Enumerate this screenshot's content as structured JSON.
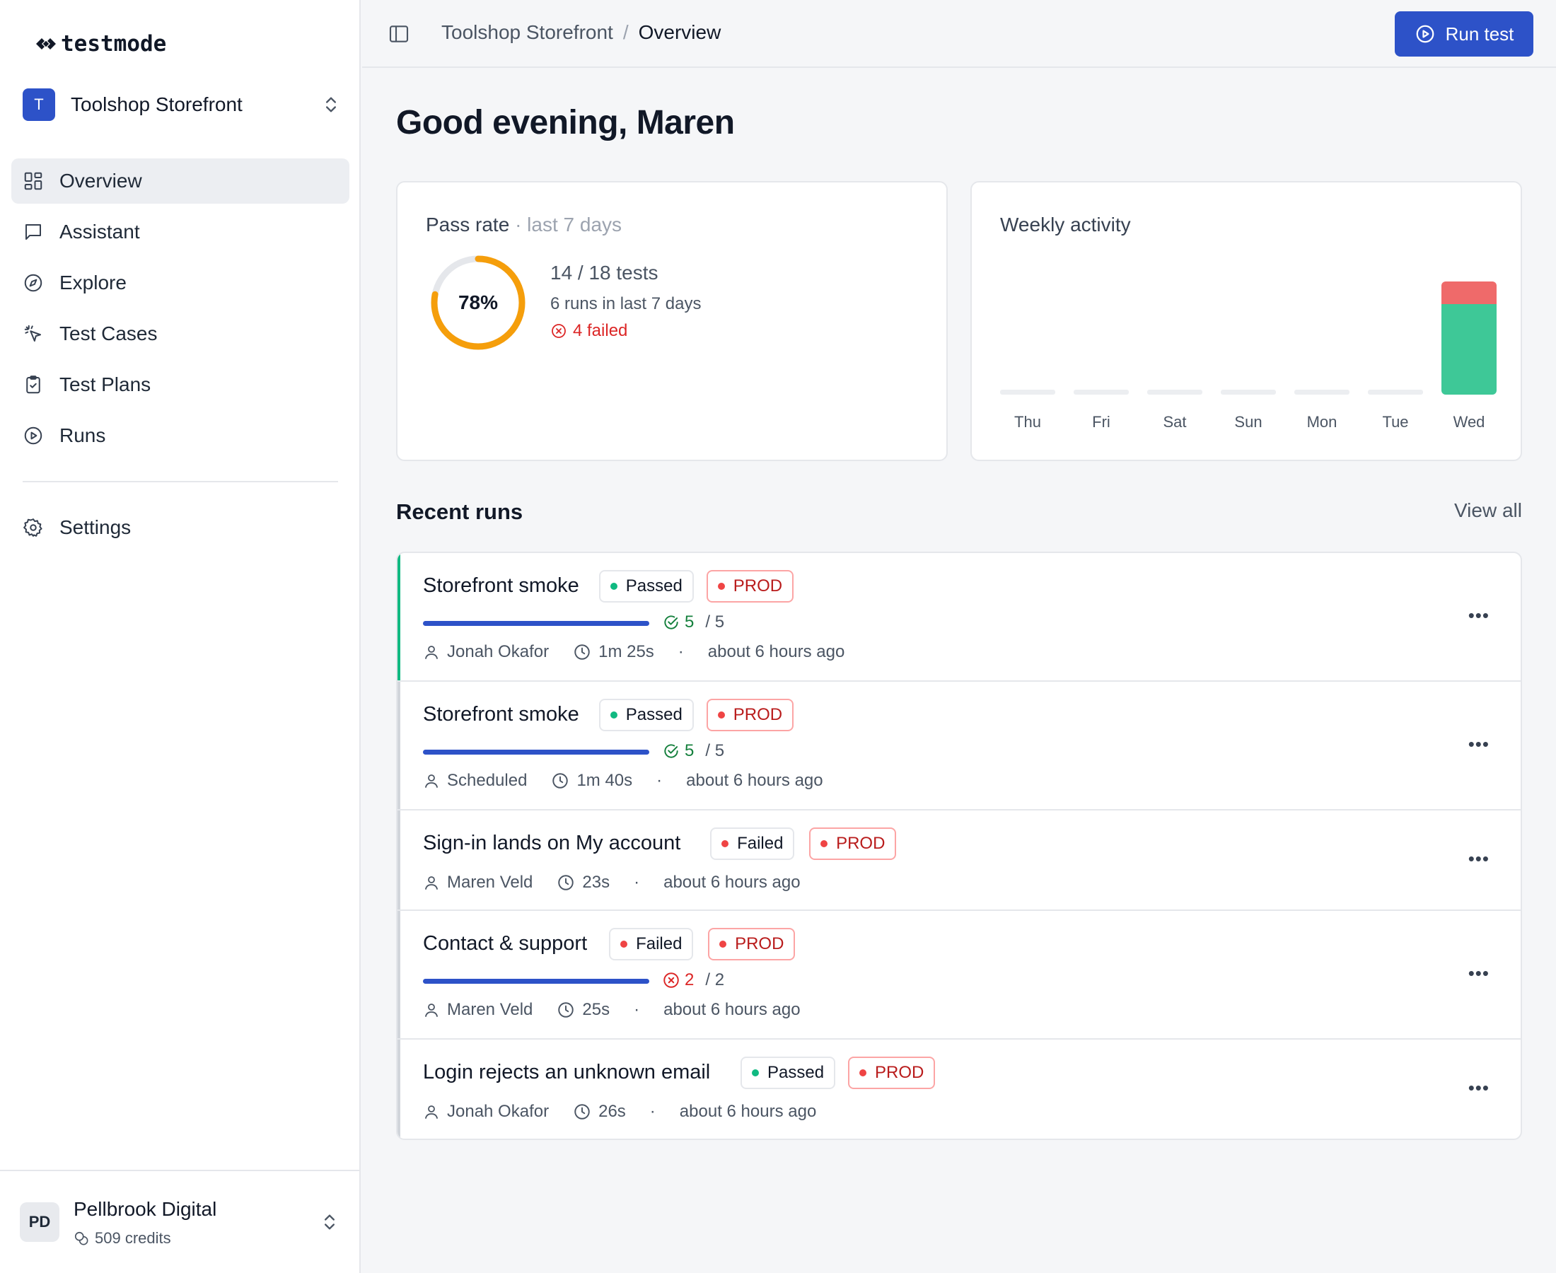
{
  "app": {
    "logo_text": "testmode"
  },
  "workspace": {
    "initial": "T",
    "name": "Toolshop Storefront"
  },
  "nav": {
    "items": [
      {
        "label": "Overview",
        "icon": "grid-icon"
      },
      {
        "label": "Assistant",
        "icon": "chat-icon"
      },
      {
        "label": "Explore",
        "icon": "compass-icon"
      },
      {
        "label": "Test Cases",
        "icon": "cursor-click-icon"
      },
      {
        "label": "Test Plans",
        "icon": "clipboard-icon"
      },
      {
        "label": "Runs",
        "icon": "play-circle-icon"
      }
    ],
    "settings_label": "Settings"
  },
  "org": {
    "initials": "PD",
    "name": "Pellbrook Digital",
    "credits": "509 credits"
  },
  "topbar": {
    "breadcrumb_parent": "Toolshop Storefront",
    "breadcrumb_sep": "/",
    "breadcrumb_current": "Overview",
    "run_button": "Run test"
  },
  "greeting": "Good evening, Maren",
  "pass_rate": {
    "title": "Pass rate",
    "subtitle": "· last 7 days",
    "percent_label": "78%",
    "percent": 0.78,
    "tests": "14 / 18 tests",
    "runs": "6 runs in last 7 days",
    "failed": "4 failed"
  },
  "activity": {
    "title": "Weekly activity",
    "days": [
      "Thu",
      "Fri",
      "Sat",
      "Sun",
      "Mon",
      "Tue",
      "Wed"
    ],
    "passed": [
      0,
      0,
      0,
      0,
      0,
      0,
      4
    ],
    "failed": [
      0,
      0,
      0,
      0,
      0,
      0,
      1
    ]
  },
  "recent": {
    "title": "Recent runs",
    "view_all": "View all"
  },
  "runs": [
    {
      "name": "Storefront smoke",
      "status": "Passed",
      "env": "PROD",
      "count_done": "5",
      "count_total": "/ 5",
      "count_kind": "ok",
      "user": "Jonah Okafor",
      "duration": "1m 25s",
      "when": "about 6 hours ago"
    },
    {
      "name": "Storefront smoke",
      "status": "Passed",
      "env": "PROD",
      "count_done": "5",
      "count_total": "/ 5",
      "count_kind": "ok",
      "user": "Scheduled",
      "duration": "1m 40s",
      "when": "about 6 hours ago"
    },
    {
      "name": "Sign-in lands on My account",
      "status": "Failed",
      "env": "PROD",
      "user": "Maren Veld",
      "duration": "23s",
      "when": "about 6 hours ago"
    },
    {
      "name": "Contact & support",
      "status": "Failed",
      "env": "PROD",
      "count_done": "2",
      "count_total": "/ 2",
      "count_kind": "bad",
      "user": "Maren Veld",
      "duration": "25s",
      "when": "about 6 hours ago"
    },
    {
      "name": "Login rejects an unknown email",
      "status": "Passed",
      "env": "PROD",
      "user": "Jonah Okafor",
      "duration": "26s",
      "when": "about 6 hours ago"
    }
  ],
  "meta_separator": "·",
  "menu_glyph": "•••",
  "colors": {
    "accent": "#2d52c8",
    "pass": "#10b981",
    "fail": "#ef4444",
    "donut": "#f59e0b",
    "bar_pass": "#3ec897",
    "bar_fail": "#ef6a6a"
  }
}
